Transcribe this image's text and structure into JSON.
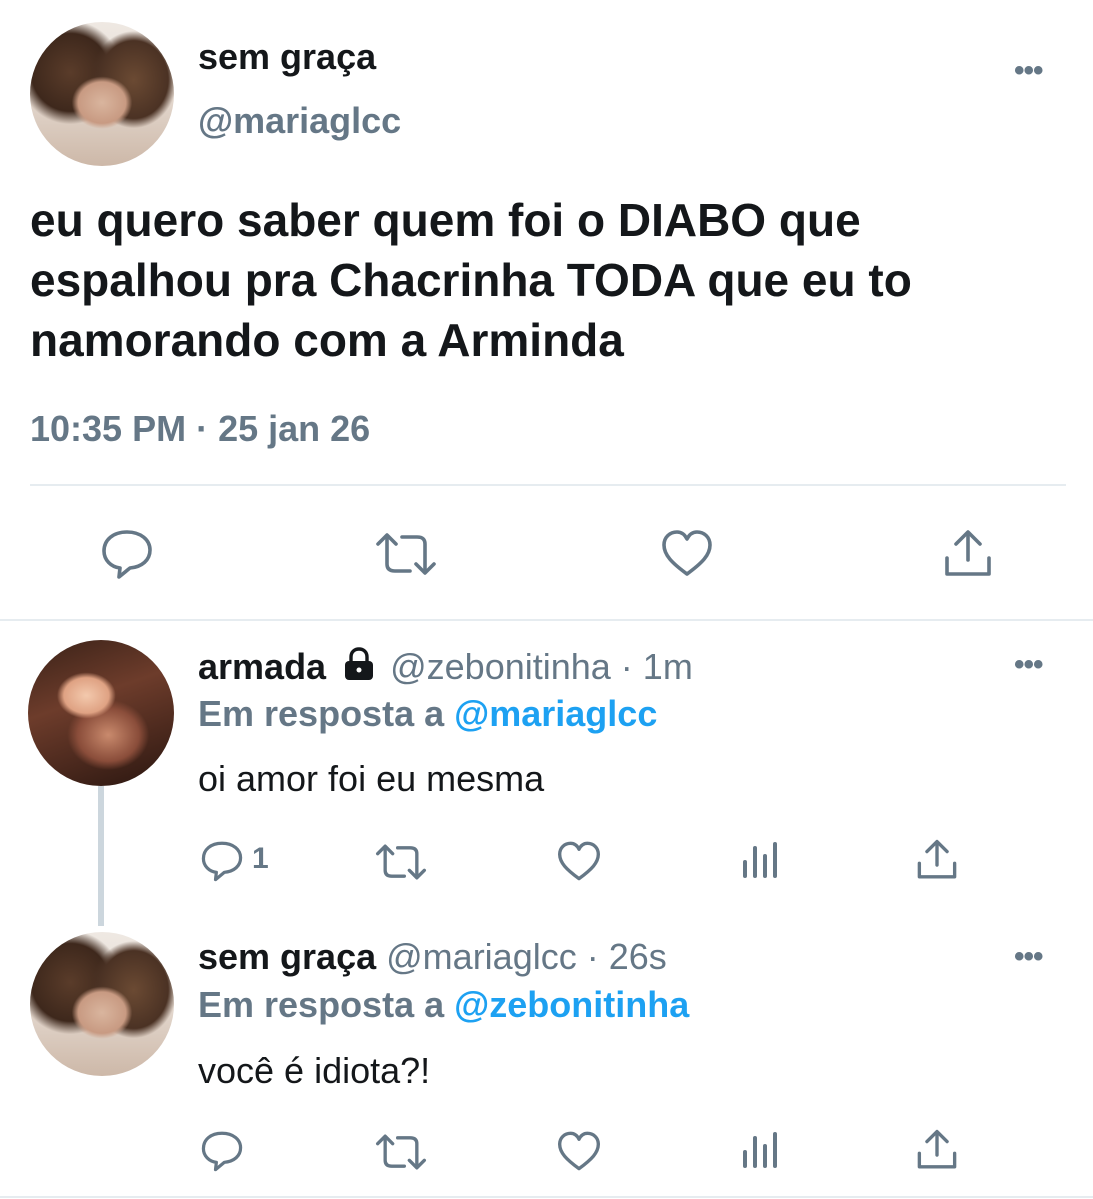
{
  "main_tweet": {
    "display_name": "sem graça",
    "handle": "@mariaglcc",
    "text_lines": [
      "eu quero saber quem foi o DIABO que",
      "espalhou pra Chacrinha TODA que eu to",
      "namorando com a Arminda"
    ],
    "timestamp": "10:35 PM · 25 jan 26",
    "more_icon": "•••",
    "actions": [
      "reply-icon",
      "retweet-icon",
      "like-icon",
      "share-icon"
    ]
  },
  "replies": [
    {
      "display_name": "armada",
      "locked_icon": "lock-icon",
      "handle_time": "@zebonitinha · 1m",
      "reply_prefix": "Em resposta a",
      "reply_to": "@mariaglcc",
      "text": "oi amor foi eu mesma",
      "reply_count": "1",
      "more_icon": "•••",
      "actions": [
        "reply-icon",
        "retweet-icon",
        "like-icon",
        "analytics-icon",
        "share-icon"
      ]
    },
    {
      "display_name": "sem graça",
      "handle_time": "@mariaglcc · 26s",
      "reply_prefix": "Em resposta a",
      "reply_to": "@zebonitinha",
      "text": "você é idiota?!",
      "more_icon": "•••",
      "actions": [
        "reply-icon",
        "retweet-icon",
        "like-icon",
        "analytics-icon",
        "share-icon"
      ]
    }
  ],
  "colors": {
    "text": "#14171a",
    "muted": "#657786",
    "link": "#1da1f2",
    "divider": "#e6ecf0"
  }
}
